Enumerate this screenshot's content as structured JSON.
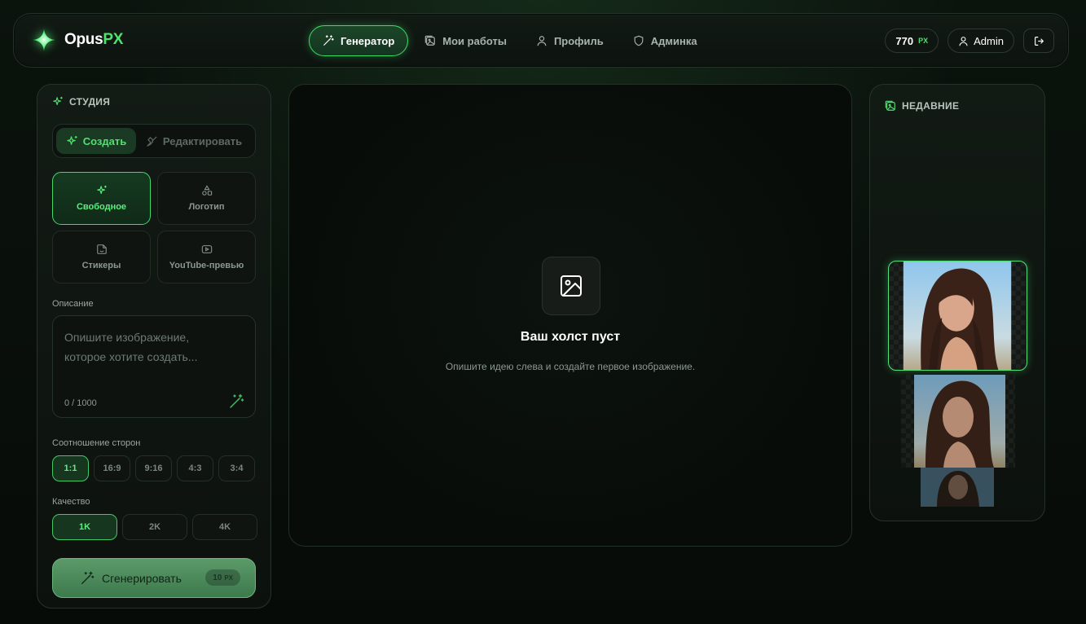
{
  "brand": {
    "name": "Opus",
    "accent": "PX",
    "accent_color": "#4ee26f"
  },
  "nav": {
    "items": [
      {
        "label": "Генератор",
        "icon": "wand-icon",
        "active": true
      },
      {
        "label": "Мои работы",
        "icon": "images-icon",
        "active": false
      },
      {
        "label": "Профиль",
        "icon": "user-icon",
        "active": false
      },
      {
        "label": "Админка",
        "icon": "shield-icon",
        "active": false
      }
    ]
  },
  "account": {
    "balance": "770",
    "balance_unit": "PX",
    "username": "Admin",
    "logout_icon": "logout-icon"
  },
  "studio": {
    "title": "СТУДИЯ",
    "tabs": {
      "create": "Создать",
      "edit": "Редактировать"
    },
    "modes": [
      {
        "label": "Свободное",
        "icon": "sparkles-icon",
        "active": true
      },
      {
        "label": "Логотип",
        "icon": "shapes-icon",
        "active": false
      },
      {
        "label": "Стикеры",
        "icon": "sticker-icon",
        "active": false
      },
      {
        "label": "YouTube-превью",
        "icon": "play-icon",
        "active": false
      }
    ],
    "description": {
      "label": "Описание",
      "placeholder": "Опишите изображение, которое хотите создать...",
      "counter": "0 / 1000"
    },
    "ratio": {
      "label": "Соотношение сторон",
      "options": [
        "1:1",
        "16:9",
        "9:16",
        "4:3",
        "3:4"
      ],
      "selected": "1:1"
    },
    "quality": {
      "label": "Качество",
      "options": [
        "1K",
        "2K",
        "4K"
      ],
      "selected": "1K"
    },
    "generate": {
      "label": "Сгенерировать",
      "cost": "10",
      "cost_unit": "PX"
    }
  },
  "canvas": {
    "title": "Ваш холст пуст",
    "subtitle": "Опишите идею слева и создайте первое изображение."
  },
  "recent": {
    "title": "НЕДАВНИЕ"
  },
  "colors": {
    "accent": "#4ee26f",
    "background": "#070b08",
    "panel": "#121a14"
  }
}
